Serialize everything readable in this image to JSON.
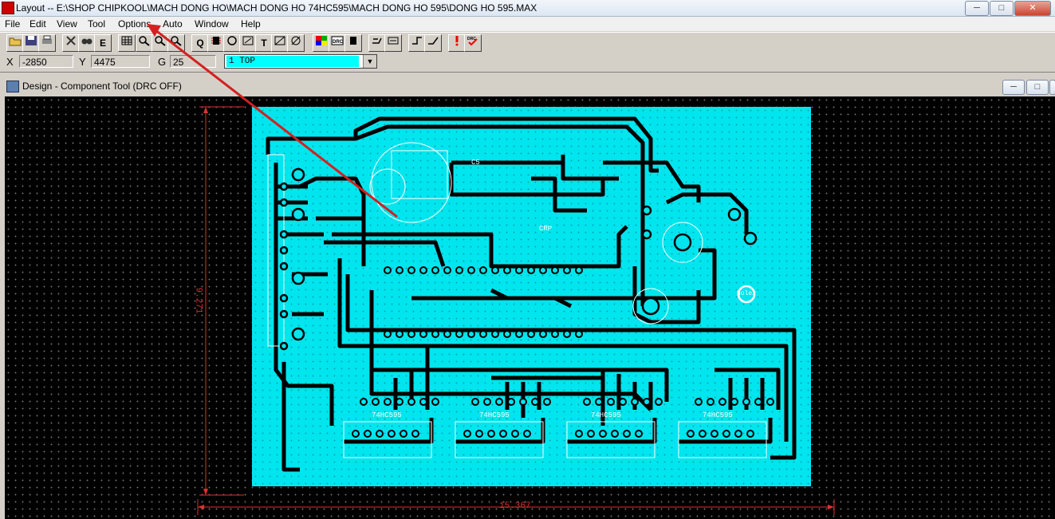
{
  "window": {
    "title": "Layout -- E:\\SHOP CHIPKOOL\\MACH DONG HO\\MACH DONG HO 74HC595\\MACH DONG HO 595\\DONG HO 595.MAX",
    "minimize": "─",
    "maximize": "□",
    "close": "✕"
  },
  "menu": {
    "items": [
      "File",
      "Edit",
      "View",
      "Tool",
      "Options",
      "Auto",
      "Window",
      "Help"
    ]
  },
  "toolbar": {
    "buttons": [
      "open-icon",
      "save-icon",
      "print-icon",
      "edit-icon",
      "cancel-icon",
      "find-icon",
      "text-edit-icon",
      "spreadsheet-icon",
      "zoom-in-icon",
      "zoom-out-icon",
      "zoom-all-icon",
      "query-icon",
      "component-icon",
      "pin-icon",
      "obstacle-icon",
      "connection-icon",
      "text-icon",
      "error-icon",
      "color-icon",
      "drc-icon",
      "swap-icon",
      "reconnect-icon",
      "route-icon",
      "unroute-icon",
      "online-drc-icon",
      "drc-check-icon"
    ],
    "glyphs": {
      "query": "Q",
      "text": "T",
      "error": "E"
    }
  },
  "coords": {
    "x_label": "X",
    "x_value": "-2850",
    "y_label": "Y",
    "y_value": "4475",
    "g_label": "G",
    "g_value": "25",
    "layer_value": "1 TOP",
    "layer_arrow": "▼"
  },
  "design_window": {
    "title": "Design - Component Tool (DRC OFF)",
    "minimize": "─",
    "maximize": "□",
    "close": "✕"
  },
  "board": {
    "width_dim": "15.367",
    "height_dim": "9.271",
    "labels": {
      "c5": "C5",
      "ic1": "74HC595",
      "ic2": "74HC595",
      "ic3": "74HC595",
      "ic4": "74HC595",
      "crp": "CRP",
      "hole": "hole2"
    }
  },
  "colors": {
    "board": "#00e5ee",
    "background": "#000000",
    "dimension": "#e03030",
    "annotation_arrow": "#d42020"
  }
}
